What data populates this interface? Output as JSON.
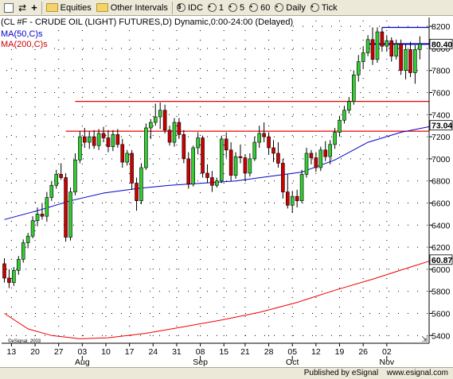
{
  "toolbar": {
    "items": [
      {
        "label": "Equities",
        "icon": "folder-icon"
      },
      {
        "label": "Other Intervals",
        "icon": "folder-icon"
      },
      {
        "label": "IDC",
        "icon": "dollar-icon"
      },
      {
        "label": "1",
        "icon": "clock-icon"
      },
      {
        "label": "5",
        "icon": "clock-icon"
      },
      {
        "label": "60",
        "icon": "clock-icon"
      },
      {
        "label": "Daily",
        "icon": "clock-icon"
      },
      {
        "label": "Tick",
        "icon": "clock-icon"
      }
    ]
  },
  "legend": {
    "title": "(CL #F - CRUDE OIL (LIGHT) FUTURES,D) Dynamic,0:00-24:00 (Delayed)",
    "ma50": "MA(50,C)s",
    "ma200": "MA(200,C)s"
  },
  "watermark": "©eSignal, 2003",
  "footer": {
    "published_by": "Published by",
    "brand": "eSignal",
    "domain": "www.esignal.com"
  },
  "colors": {
    "up": "#33cc33",
    "down": "#cc0000",
    "ma50": "#0000cc",
    "ma200": "#ee0000",
    "resistance": "#ee0000",
    "top_line": "#0000cc",
    "label_ma50": "#0000cc",
    "label_ma200": "#cc0000"
  },
  "chart_data": {
    "type": "candlestick",
    "y_ticks": [
      8200,
      8000,
      7800,
      7600,
      7400,
      7200,
      7000,
      6800,
      6600,
      6400,
      6200,
      6000,
      5800,
      5600,
      5400
    ],
    "ylim": [
      5330,
      8280
    ],
    "x_ticks": [
      "13",
      "20",
      "27",
      "03",
      "10",
      "17",
      "24",
      "31",
      "08",
      "15",
      "21",
      "28",
      "05",
      "12",
      "19",
      "26",
      "02"
    ],
    "months": [
      "Aug",
      "Sep",
      "Oct",
      "Nov"
    ],
    "grid": true,
    "price_labels": [
      {
        "text": "80.40",
        "value": 8040,
        "color": "#0000cc"
      },
      {
        "text": "73.04",
        "value": 7304,
        "color": "#0000cc"
      },
      {
        "text": "60.87",
        "value": 6087,
        "color": "#cc0000"
      }
    ],
    "hlines": [
      {
        "value": 8190,
        "x_start_day": 80,
        "color": "#0000cc"
      },
      {
        "value": 8040,
        "x_start_day": 77,
        "color": "#0000cc"
      },
      {
        "value": 7520,
        "x_start_day": 15,
        "color": "#ee0000"
      },
      {
        "value": 7250,
        "x_start_day": 13,
        "color": "#ee0000"
      }
    ],
    "ma50": [
      [
        0,
        6450
      ],
      [
        7,
        6530
      ],
      [
        14,
        6620
      ],
      [
        21,
        6690
      ],
      [
        28,
        6730
      ],
      [
        35,
        6760
      ],
      [
        42,
        6780
      ],
      [
        49,
        6800
      ],
      [
        56,
        6840
      ],
      [
        63,
        6880
      ],
      [
        70,
        6990
      ],
      [
        77,
        7150
      ],
      [
        84,
        7240
      ],
      [
        91,
        7300
      ]
    ],
    "ma200": [
      [
        0,
        5600
      ],
      [
        5,
        5460
      ],
      [
        10,
        5400
      ],
      [
        16,
        5370
      ],
      [
        22,
        5380
      ],
      [
        30,
        5420
      ],
      [
        38,
        5480
      ],
      [
        46,
        5540
      ],
      [
        54,
        5610
      ],
      [
        62,
        5700
      ],
      [
        70,
        5810
      ],
      [
        78,
        5910
      ],
      [
        86,
        6020
      ],
      [
        91,
        6087
      ]
    ],
    "candles": [
      {
        "d": 0,
        "o": 6050,
        "h": 6100,
        "l": 5880,
        "c": 5920
      },
      {
        "d": 1,
        "o": 5920,
        "h": 6000,
        "l": 5830,
        "c": 5880
      },
      {
        "d": 2,
        "o": 5880,
        "h": 6020,
        "l": 5850,
        "c": 5990
      },
      {
        "d": 3,
        "o": 5990,
        "h": 6120,
        "l": 5950,
        "c": 6090
      },
      {
        "d": 4,
        "o": 6090,
        "h": 6270,
        "l": 6060,
        "c": 6240
      },
      {
        "d": 5,
        "o": 6240,
        "h": 6330,
        "l": 6190,
        "c": 6300
      },
      {
        "d": 6,
        "o": 6300,
        "h": 6480,
        "l": 6280,
        "c": 6440
      },
      {
        "d": 7,
        "o": 6440,
        "h": 6560,
        "l": 6390,
        "c": 6500
      },
      {
        "d": 8,
        "o": 6500,
        "h": 6600,
        "l": 6450,
        "c": 6480
      },
      {
        "d": 9,
        "o": 6480,
        "h": 6700,
        "l": 6430,
        "c": 6650
      },
      {
        "d": 10,
        "o": 6650,
        "h": 6800,
        "l": 6620,
        "c": 6760
      },
      {
        "d": 11,
        "o": 6760,
        "h": 6900,
        "l": 6730,
        "c": 6860
      },
      {
        "d": 12,
        "o": 6860,
        "h": 6960,
        "l": 6810,
        "c": 6830
      },
      {
        "d": 13,
        "o": 6830,
        "h": 6870,
        "l": 6250,
        "c": 6290
      },
      {
        "d": 14,
        "o": 6290,
        "h": 6740,
        "l": 6260,
        "c": 6700
      },
      {
        "d": 15,
        "o": 6700,
        "h": 7050,
        "l": 6670,
        "c": 6990
      },
      {
        "d": 16,
        "o": 6990,
        "h": 7250,
        "l": 6960,
        "c": 7200
      },
      {
        "d": 17,
        "o": 7200,
        "h": 7280,
        "l": 7100,
        "c": 7150
      },
      {
        "d": 18,
        "o": 7150,
        "h": 7250,
        "l": 7090,
        "c": 7200
      },
      {
        "d": 19,
        "o": 7200,
        "h": 7260,
        "l": 7090,
        "c": 7120
      },
      {
        "d": 20,
        "o": 7120,
        "h": 7270,
        "l": 7080,
        "c": 7230
      },
      {
        "d": 21,
        "o": 7230,
        "h": 7290,
        "l": 7150,
        "c": 7190
      },
      {
        "d": 22,
        "o": 7190,
        "h": 7260,
        "l": 7060,
        "c": 7110
      },
      {
        "d": 23,
        "o": 7110,
        "h": 7260,
        "l": 7070,
        "c": 7220
      },
      {
        "d": 24,
        "o": 7220,
        "h": 7270,
        "l": 7100,
        "c": 7130
      },
      {
        "d": 25,
        "o": 7130,
        "h": 7180,
        "l": 6920,
        "c": 6970
      },
      {
        "d": 26,
        "o": 6970,
        "h": 7080,
        "l": 6940,
        "c": 7050
      },
      {
        "d": 27,
        "o": 7050,
        "h": 7080,
        "l": 6720,
        "c": 6780
      },
      {
        "d": 28,
        "o": 6780,
        "h": 6830,
        "l": 6530,
        "c": 6620
      },
      {
        "d": 29,
        "o": 6620,
        "h": 6960,
        "l": 6590,
        "c": 6920
      },
      {
        "d": 30,
        "o": 6920,
        "h": 7320,
        "l": 6900,
        "c": 7280
      },
      {
        "d": 31,
        "o": 7280,
        "h": 7360,
        "l": 7180,
        "c": 7330
      },
      {
        "d": 32,
        "o": 7330,
        "h": 7500,
        "l": 7300,
        "c": 7380
      },
      {
        "d": 33,
        "o": 7380,
        "h": 7510,
        "l": 7270,
        "c": 7440
      },
      {
        "d": 34,
        "o": 7440,
        "h": 7490,
        "l": 7230,
        "c": 7260
      },
      {
        "d": 35,
        "o": 7260,
        "h": 7300,
        "l": 7120,
        "c": 7150
      },
      {
        "d": 36,
        "o": 7150,
        "h": 7370,
        "l": 7110,
        "c": 7330
      },
      {
        "d": 37,
        "o": 7330,
        "h": 7370,
        "l": 7180,
        "c": 7220
      },
      {
        "d": 38,
        "o": 7220,
        "h": 7260,
        "l": 6960,
        "c": 7000
      },
      {
        "d": 39,
        "o": 7000,
        "h": 7060,
        "l": 6730,
        "c": 6770
      },
      {
        "d": 40,
        "o": 6770,
        "h": 7120,
        "l": 6750,
        "c": 7100
      },
      {
        "d": 41,
        "o": 7100,
        "h": 7240,
        "l": 7040,
        "c": 7190
      },
      {
        "d": 42,
        "o": 7190,
        "h": 7210,
        "l": 6830,
        "c": 6870
      },
      {
        "d": 43,
        "o": 6870,
        "h": 6950,
        "l": 6780,
        "c": 6830
      },
      {
        "d": 44,
        "o": 6830,
        "h": 6890,
        "l": 6700,
        "c": 6760
      },
      {
        "d": 45,
        "o": 6760,
        "h": 6830,
        "l": 6740,
        "c": 6800
      },
      {
        "d": 46,
        "o": 6800,
        "h": 7210,
        "l": 6780,
        "c": 7180
      },
      {
        "d": 47,
        "o": 7180,
        "h": 7240,
        "l": 7010,
        "c": 7080
      },
      {
        "d": 48,
        "o": 7080,
        "h": 7150,
        "l": 6800,
        "c": 6850
      },
      {
        "d": 49,
        "o": 6850,
        "h": 7060,
        "l": 6820,
        "c": 7020
      },
      {
        "d": 50,
        "o": 7020,
        "h": 7130,
        "l": 6960,
        "c": 7010
      },
      {
        "d": 51,
        "o": 7010,
        "h": 7040,
        "l": 6800,
        "c": 6870
      },
      {
        "d": 52,
        "o": 6870,
        "h": 7050,
        "l": 6840,
        "c": 7000
      },
      {
        "d": 53,
        "o": 7000,
        "h": 7200,
        "l": 6980,
        "c": 7150
      },
      {
        "d": 54,
        "o": 7150,
        "h": 7300,
        "l": 7100,
        "c": 7230
      },
      {
        "d": 55,
        "o": 7230,
        "h": 7330,
        "l": 7150,
        "c": 7200
      },
      {
        "d": 56,
        "o": 7200,
        "h": 7240,
        "l": 7040,
        "c": 7100
      },
      {
        "d": 57,
        "o": 7100,
        "h": 7170,
        "l": 6970,
        "c": 7050
      },
      {
        "d": 58,
        "o": 7050,
        "h": 7150,
        "l": 6920,
        "c": 6960
      },
      {
        "d": 59,
        "o": 6960,
        "h": 7000,
        "l": 6640,
        "c": 6700
      },
      {
        "d": 60,
        "o": 6700,
        "h": 6860,
        "l": 6550,
        "c": 6580
      },
      {
        "d": 61,
        "o": 6580,
        "h": 6710,
        "l": 6510,
        "c": 6660
      },
      {
        "d": 62,
        "o": 6660,
        "h": 6720,
        "l": 6560,
        "c": 6620
      },
      {
        "d": 63,
        "o": 6620,
        "h": 6900,
        "l": 6600,
        "c": 6860
      },
      {
        "d": 64,
        "o": 6860,
        "h": 7100,
        "l": 6830,
        "c": 7050
      },
      {
        "d": 65,
        "o": 7050,
        "h": 7080,
        "l": 6950,
        "c": 7010
      },
      {
        "d": 66,
        "o": 7010,
        "h": 7060,
        "l": 6880,
        "c": 6920
      },
      {
        "d": 67,
        "o": 6920,
        "h": 7110,
        "l": 6890,
        "c": 7080
      },
      {
        "d": 68,
        "o": 7080,
        "h": 7160,
        "l": 6980,
        "c": 7020
      },
      {
        "d": 69,
        "o": 7020,
        "h": 7170,
        "l": 6950,
        "c": 7130
      },
      {
        "d": 70,
        "o": 7130,
        "h": 7280,
        "l": 7090,
        "c": 7240
      },
      {
        "d": 71,
        "o": 7240,
        "h": 7390,
        "l": 7200,
        "c": 7350
      },
      {
        "d": 72,
        "o": 7350,
        "h": 7480,
        "l": 7320,
        "c": 7440
      },
      {
        "d": 73,
        "o": 7440,
        "h": 7560,
        "l": 7410,
        "c": 7520
      },
      {
        "d": 74,
        "o": 7520,
        "h": 7800,
        "l": 7490,
        "c": 7760
      },
      {
        "d": 75,
        "o": 7760,
        "h": 7940,
        "l": 7700,
        "c": 7880
      },
      {
        "d": 76,
        "o": 7880,
        "h": 8020,
        "l": 7820,
        "c": 7960
      },
      {
        "d": 77,
        "o": 7960,
        "h": 8120,
        "l": 7930,
        "c": 8080
      },
      {
        "d": 78,
        "o": 8080,
        "h": 8190,
        "l": 7850,
        "c": 7900
      },
      {
        "d": 79,
        "o": 7900,
        "h": 8190,
        "l": 7870,
        "c": 8150
      },
      {
        "d": 80,
        "o": 8150,
        "h": 8190,
        "l": 7970,
        "c": 8020
      },
      {
        "d": 81,
        "o": 8020,
        "h": 8120,
        "l": 7970,
        "c": 8070
      },
      {
        "d": 82,
        "o": 8070,
        "h": 8100,
        "l": 7880,
        "c": 7930
      },
      {
        "d": 83,
        "o": 7930,
        "h": 8080,
        "l": 7900,
        "c": 8040
      },
      {
        "d": 84,
        "o": 8040,
        "h": 8080,
        "l": 7760,
        "c": 7800
      },
      {
        "d": 85,
        "o": 7800,
        "h": 8040,
        "l": 7720,
        "c": 7990
      },
      {
        "d": 86,
        "o": 7990,
        "h": 8060,
        "l": 7740,
        "c": 7780
      },
      {
        "d": 87,
        "o": 7780,
        "h": 8030,
        "l": 7680,
        "c": 7990
      },
      {
        "d": 88,
        "o": 7990,
        "h": 8110,
        "l": 7900,
        "c": 8040
      }
    ]
  }
}
